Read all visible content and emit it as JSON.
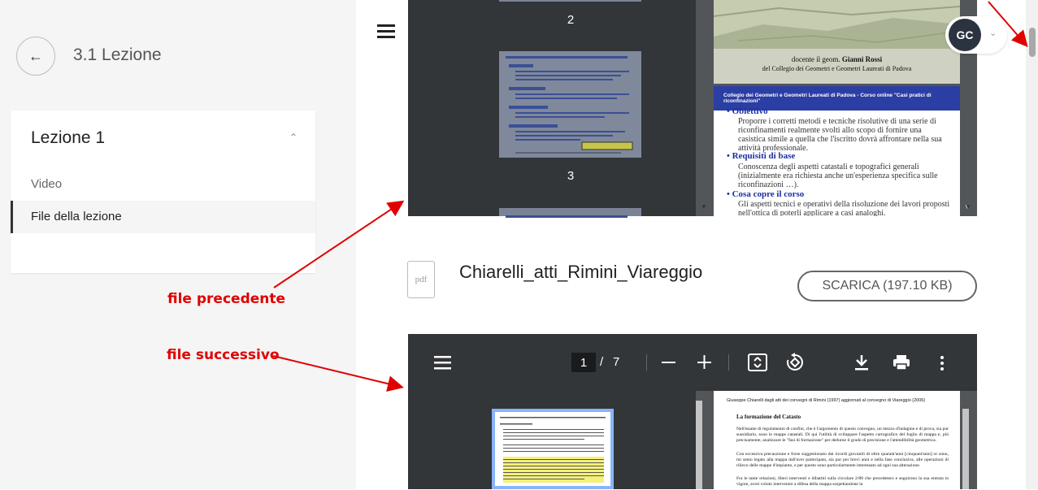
{
  "sidebar": {
    "back_icon": "arrow-left-icon",
    "lesson_title": "3.1 Lezione",
    "card_title": "Lezione 1",
    "collapse_icon": "chevron-up-icon",
    "items": [
      {
        "label": "Video"
      },
      {
        "label": "File della lezione"
      }
    ]
  },
  "annotations": {
    "prev": "file precedente",
    "next": "file successivo",
    "arrow_color": "#e00000"
  },
  "viewer1": {
    "thumb_pages": [
      "2",
      "3"
    ],
    "slide1_line1": "docente il geom.",
    "slide1_name": "Gianni Rossi",
    "slide1_line2": "del Collegio dei Geometri e Geometri Laureati di Padova",
    "slide2_header": "Collegio dei Geometri e Geometri Laureati di Padova - Corso online \"Casi pratici di riconfinazioni\"",
    "bullets": [
      {
        "title": "Obiettivo",
        "text": "Proporre i corretti metodi e tecniche risolutive di una serie di riconfinamenti realmente svolti allo scopo di fornire una casistica simile a quella che l'iscritto dovrà affrontare nella sua attività professionale."
      },
      {
        "title": "Requisiti di base",
        "text": "Conoscenza degli aspetti catastali e topografici generali (inizialmente era richiesta anche un'esperienza specifica sulle riconfinazioni …)."
      },
      {
        "title": "Cosa copre il corso",
        "text": "Gli aspetti tecnici e operativi della risoluzione dei lavori proposti nell'ottica di poterli applicare a casi analoghi."
      }
    ]
  },
  "user": {
    "initials": "GC",
    "avatar_color": "#2b3340"
  },
  "file": {
    "icon_label": "pdf",
    "name": "Chiarelli_atti_Rimini_Viareggio",
    "download_label": "SCARICA (197.10 KB)"
  },
  "viewer2": {
    "current_page": "1",
    "separator": "/",
    "total_pages": "7",
    "page_header": "Giuseppe Chiarelli dagli atti dei convegni di Rimini (1997) aggiornati al convegno di Viareggio (2006)",
    "section_title": "La formazione del Catasto",
    "para1": "Nell'esame di regolamento di confini, che è l'argomento di questo convegno, un mezzo d'indagine e di prova, sia pur sussidiario, sono le mappe catastali. Di qui l'utilità di sviluppare l'aspetto cartografico del foglio di mappa e, più precisamente, analizzare le \"fasi di formazione\" per dedurne il grado di precisione e l'attendibilità geometrica.",
    "para2": "Con eccessiva precauzione e forse suggestionato dai ricordi giovanili di oltre quarant'anni [cinquant'anni] or sono, mi sento legato alla mappa dall'aver partecipato, sia pur per brevi anni e nella fase conclusiva, alle operazioni di rilievo delle mappe d'impianto, e per questo sono particolarmente interessato ad ogni sua alterazione.",
    "para3": "Fra le tante relazioni, liberi interventi e dibattiti sulla circolare 2/88 che precedetero e seguirono la sua entrata in vigore, avrei voluto intervenire a difesa della mappa sospettandone la"
  },
  "accent_blue": "#8ab4f8",
  "viewer_bg": "#323639"
}
